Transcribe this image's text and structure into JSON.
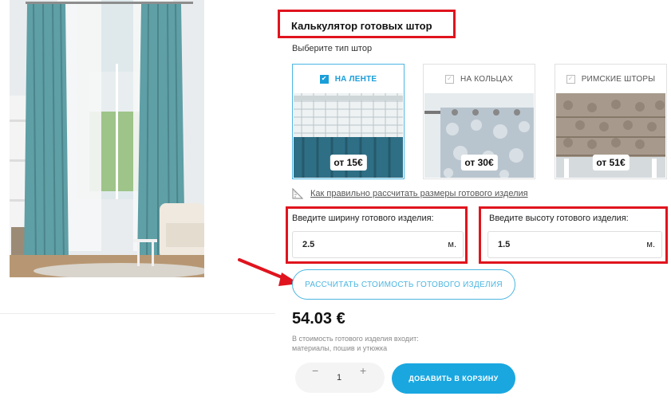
{
  "calculator": {
    "title": "Калькулятор готовых штор",
    "type_prompt": "Выберите тип штор",
    "types": [
      {
        "label": "НА ЛЕНТЕ",
        "price": "от 15€",
        "selected": true
      },
      {
        "label": "НА КОЛЬЦАХ",
        "price": "от 30€",
        "selected": false
      },
      {
        "label": "РИМСКИЕ ШТОРЫ",
        "price": "от 51€",
        "selected": false
      }
    ],
    "help_link": "Как правильно рассчитать размеры готового изделия",
    "width": {
      "label": "Введите ширину готового изделия:",
      "value": "2.5",
      "unit": "м."
    },
    "height": {
      "label": "Введите высоту готового изделия:",
      "value": "1.5",
      "unit": "м."
    },
    "calc_button": "РАССЧИТАТЬ СТОИМОСТЬ ГОТОВОГО ИЗДЕЛИЯ",
    "price": "54.03 €",
    "price_note": "В стоимость готового изделия входит: материалы, пошив и утюжка"
  },
  "cart": {
    "minus": "−",
    "plus": "+",
    "quantity": "1",
    "add_button": "ДОБАВИТЬ В КОРЗИНУ"
  },
  "colors": {
    "accent": "#1aa7e0",
    "highlight_red": "#e0141e",
    "curtain_teal": "#5f9fa6"
  },
  "icons": {
    "selected_check": "✔",
    "unselected_check": "✓"
  }
}
